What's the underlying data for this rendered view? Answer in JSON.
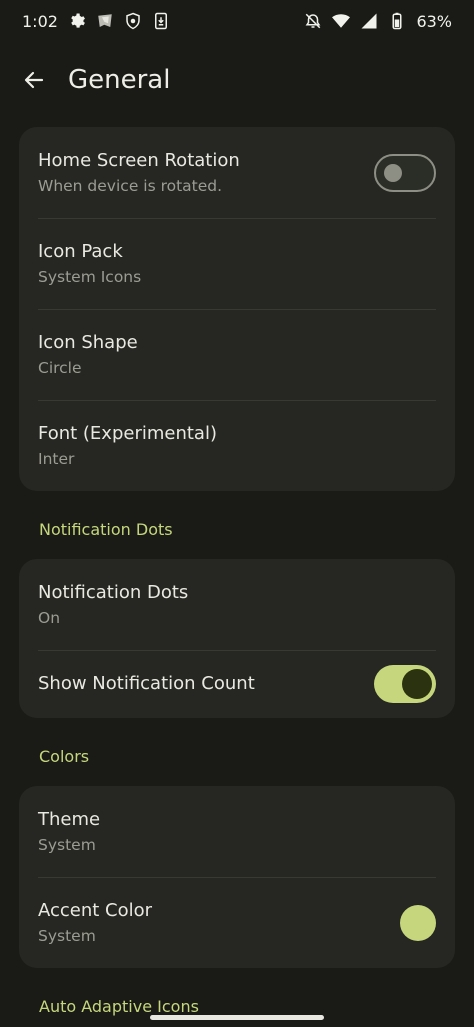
{
  "status_bar": {
    "time": "1:02",
    "battery": "63%",
    "icons_left": [
      "gear-icon",
      "shield-vpn-icon",
      "bug-shield-icon",
      "download-box-icon"
    ],
    "icons_right": [
      "alarm-off-icon",
      "wifi-icon",
      "signal-icon",
      "battery-icon"
    ]
  },
  "header": {
    "title": "General",
    "back_icon": "arrow-left-icon"
  },
  "cards": {
    "general": {
      "items": [
        {
          "title": "Home Screen Rotation",
          "subtitle": "When device is rotated.",
          "control": "switch",
          "checked": false
        },
        {
          "title": "Icon Pack",
          "subtitle": "System Icons"
        },
        {
          "title": "Icon Shape",
          "subtitle": "Circle"
        },
        {
          "title": "Font (Experimental)",
          "subtitle": "Inter"
        }
      ]
    },
    "notification_dots": {
      "header": "Notification Dots",
      "items": [
        {
          "title": "Notification Dots",
          "subtitle": "On"
        },
        {
          "title": "Show Notification Count",
          "control": "switch",
          "checked": true
        }
      ]
    },
    "colors": {
      "header": "Colors",
      "items": [
        {
          "title": "Theme",
          "subtitle": "System"
        },
        {
          "title": "Accent Color",
          "subtitle": "System",
          "swatch": "#c5d67c"
        }
      ]
    },
    "auto_adaptive": {
      "header": "Auto Adaptive Icons"
    }
  },
  "colors": {
    "background": "#1a1b17",
    "card": "#262722",
    "accent": "#c5d67c"
  }
}
